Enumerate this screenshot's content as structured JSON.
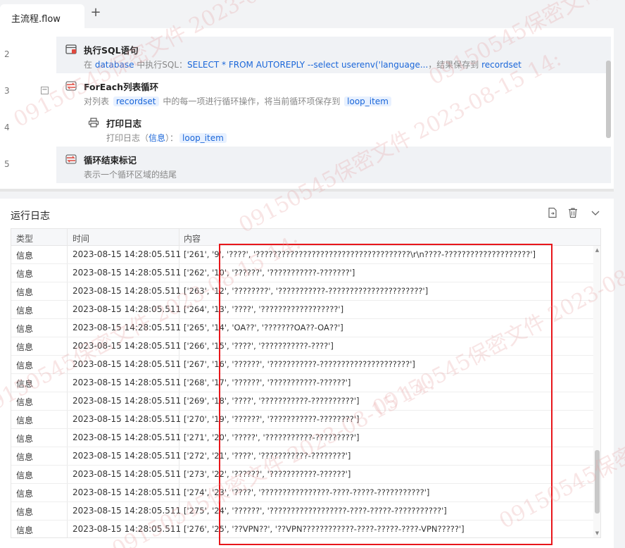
{
  "tabs": [
    {
      "label": "主流程.flow",
      "active": true
    }
  ],
  "editor": {
    "steps": [
      {
        "line": "2",
        "title": "执行SQL语句",
        "icon": "sql-icon",
        "desc": [
          {
            "t": "在 "
          },
          {
            "t": "database",
            "k": "kw"
          },
          {
            "t": " 中执行SQL："
          },
          {
            "t": "SELECT * FROM AUTOREPLY --select userenv('language...",
            "k": "kw"
          },
          {
            "t": "，结果保存到 "
          },
          {
            "t": "recordset",
            "k": "kw"
          }
        ]
      },
      {
        "line": "3",
        "title": "ForEach列表循环",
        "icon": "loop-icon",
        "desc": [
          {
            "t": "对列表 "
          },
          {
            "t": "recordset",
            "k": "tag"
          },
          {
            "t": " 中的每一项进行循环操作，将当前循环项保存到 "
          },
          {
            "t": "loop_item",
            "k": "tag"
          }
        ]
      },
      {
        "line": "4",
        "title": "打印日志",
        "icon": "printer-icon",
        "desc": [
          {
            "t": "打印日志（"
          },
          {
            "t": "信息",
            "k": "kw"
          },
          {
            "t": "）："
          },
          {
            "t": "loop_item",
            "k": "tag"
          }
        ]
      },
      {
        "line": "5",
        "title": "循环结束标记",
        "icon": "loop-end-icon",
        "desc": [
          {
            "t": "表示一个循环区域的结尾"
          }
        ]
      }
    ]
  },
  "log": {
    "title": "运行日志",
    "columns": [
      "类型",
      "时间",
      "内容"
    ],
    "rows": [
      {
        "type": "信息",
        "time": "2023-08-15 14:28:05.511",
        "content": "['261', '9', '????', '????????????????????????????????????\\r\\n????-????????????????????']"
      },
      {
        "type": "信息",
        "time": "2023-08-15 14:28:05.511",
        "content": "['262', '10', '??????', '???????????-???????']"
      },
      {
        "type": "信息",
        "time": "2023-08-15 14:28:05.511",
        "content": "['263', '12', '????????', '???????????-??????????????????????']"
      },
      {
        "type": "信息",
        "time": "2023-08-15 14:28:05.511",
        "content": "['264', '13', '????', '??????????????????']"
      },
      {
        "type": "信息",
        "time": "2023-08-15 14:28:05.511",
        "content": "['265', '14', 'OA??', '???????OA??-OA??']"
      },
      {
        "type": "信息",
        "time": "2023-08-15 14:28:05.511",
        "content": "['266', '15', '????', '???????????-????']"
      },
      {
        "type": "信息",
        "time": "2023-08-15 14:28:05.511",
        "content": "['267', '16', '??????', '???????????-?????????????????????']"
      },
      {
        "type": "信息",
        "time": "2023-08-15 14:28:05.511",
        "content": "['268', '17', '??????', '???????????-??????']"
      },
      {
        "type": "信息",
        "time": "2023-08-15 14:28:05.511",
        "content": "['269', '18', '????', '???????????-??????????']"
      },
      {
        "type": "信息",
        "time": "2023-08-15 14:28:05.511",
        "content": "['270', '19', '??????', '???????????-????????']"
      },
      {
        "type": "信息",
        "time": "2023-08-15 14:28:05.511",
        "content": "['271', '20', '?????', '???????????-?????????']"
      },
      {
        "type": "信息",
        "time": "2023-08-15 14:28:05.511",
        "content": "['272', '21', '????', '???????????-????????']"
      },
      {
        "type": "信息",
        "time": "2023-08-15 14:28:05.511",
        "content": "['273', '22', '??????', '???????????-??????']"
      },
      {
        "type": "信息",
        "time": "2023-08-15 14:28:05.511",
        "content": "['274', '23', '????', '????????????????-????-?????-???????????']"
      },
      {
        "type": "信息",
        "time": "2023-08-15 14:28:05.511",
        "content": "['275', '24', '??????', '??????????????????-????-?????-???????????']"
      },
      {
        "type": "信息",
        "time": "2023-08-15 14:28:05.511",
        "content": "['276', '25', '??VPN??', '??VPN????????????-????-?????-????-VPN?????']"
      }
    ]
  },
  "watermark_text": "09150545保密文件 2023-08-15 14:",
  "colors": {
    "accent": "#1a66d9",
    "highlight_box": "#e8161b"
  }
}
